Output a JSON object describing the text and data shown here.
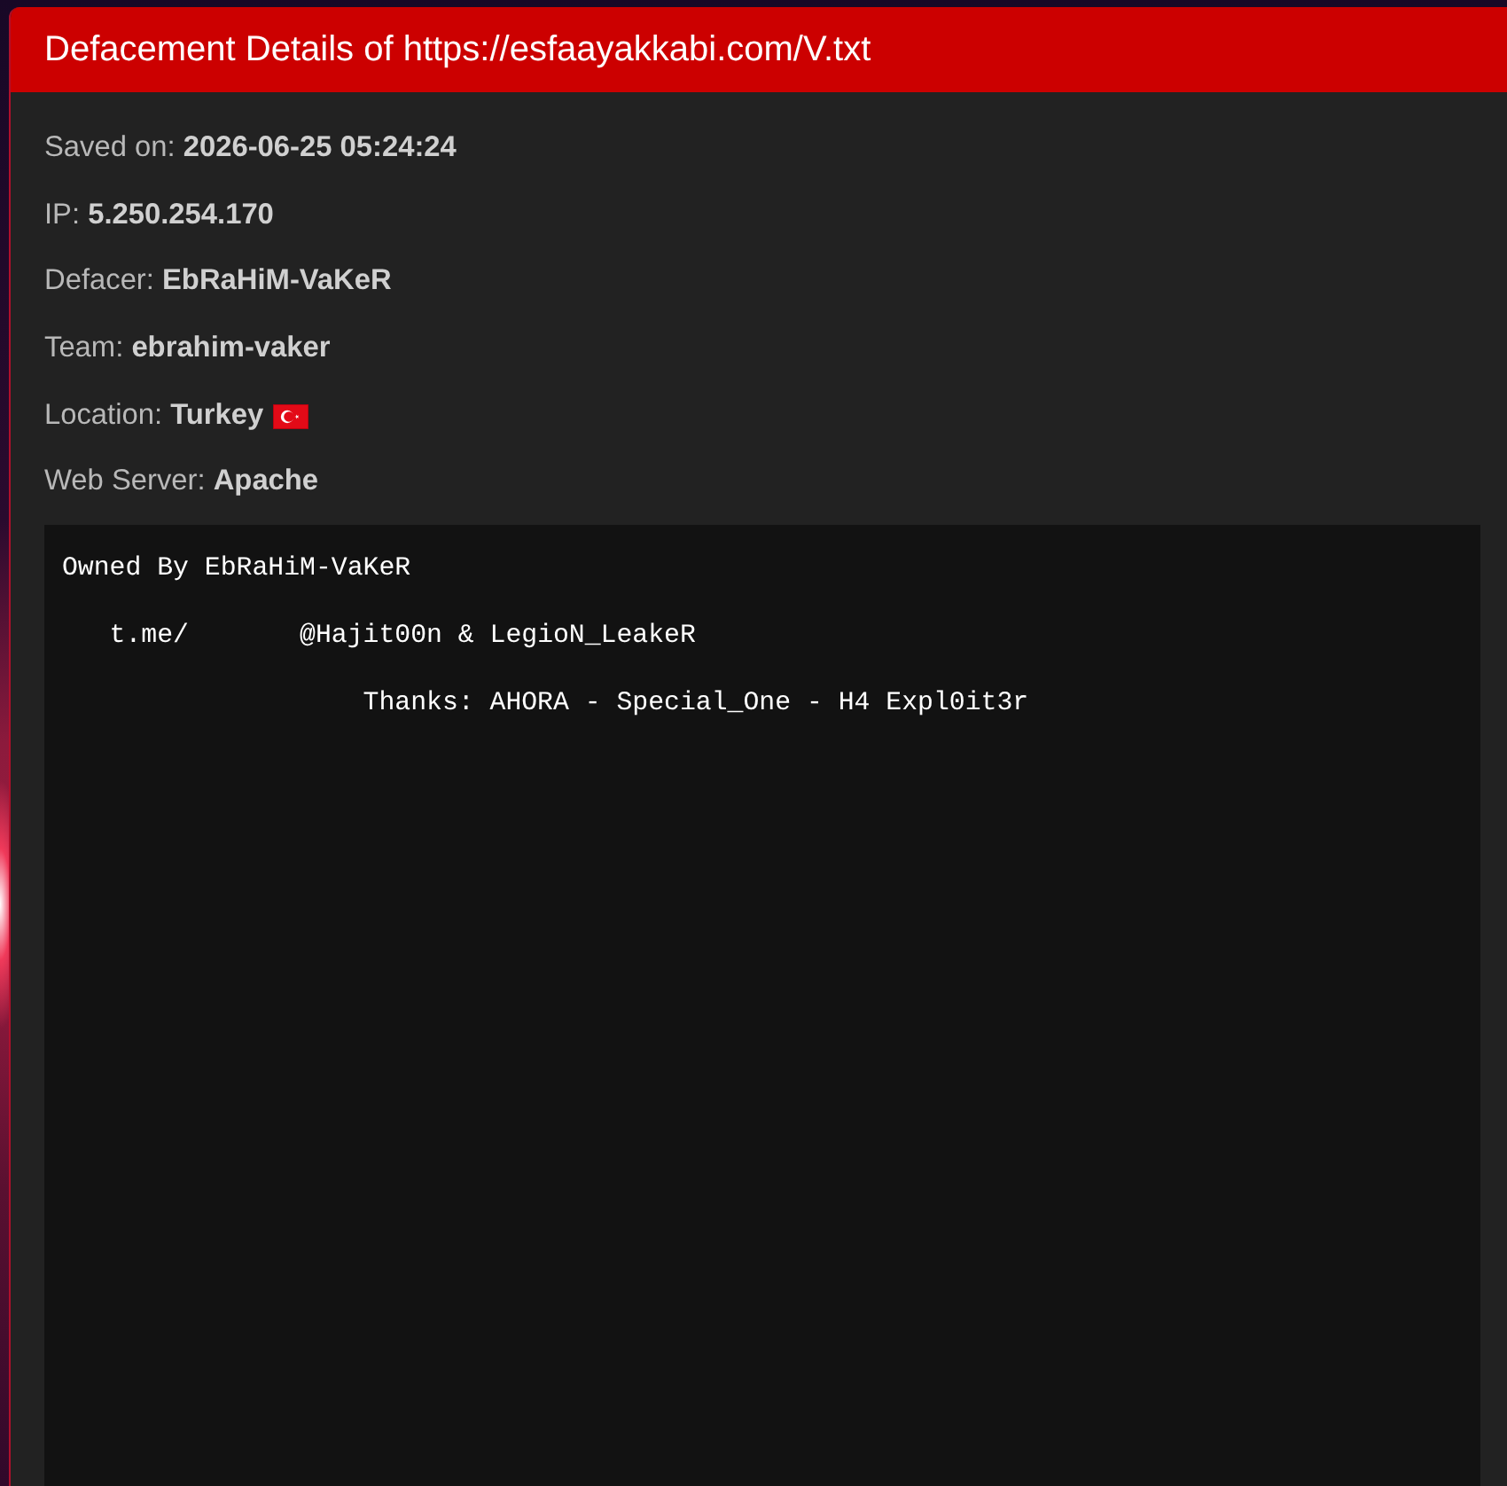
{
  "header": {
    "title": "Defacement Details of https://esfaayakkabi.com/V.txt"
  },
  "details": [
    {
      "kind": "text",
      "label": "Saved on:",
      "value": "2026-06-25 05:24:24"
    },
    {
      "kind": "text",
      "label": "IP:",
      "value": "5.250.254.170"
    },
    {
      "kind": "text",
      "label": "Defacer:",
      "value": "EbRaHiM-VaKeR"
    },
    {
      "kind": "text",
      "label": "Team:",
      "value": "ebrahim-vaker"
    },
    {
      "kind": "country",
      "label": "Location:",
      "value": "Turkey"
    },
    {
      "kind": "text",
      "label": "Web Server:",
      "value": "Apache"
    }
  ],
  "mirror_text": {
    "lines": [
      "Owned By EbRaHiM-VaKeR",
      "   t.me/       @Hajit00n & LegioN_LeakeR",
      "                   Thanks: AHORA - Special_One - H4 Expl0it3r"
    ]
  }
}
